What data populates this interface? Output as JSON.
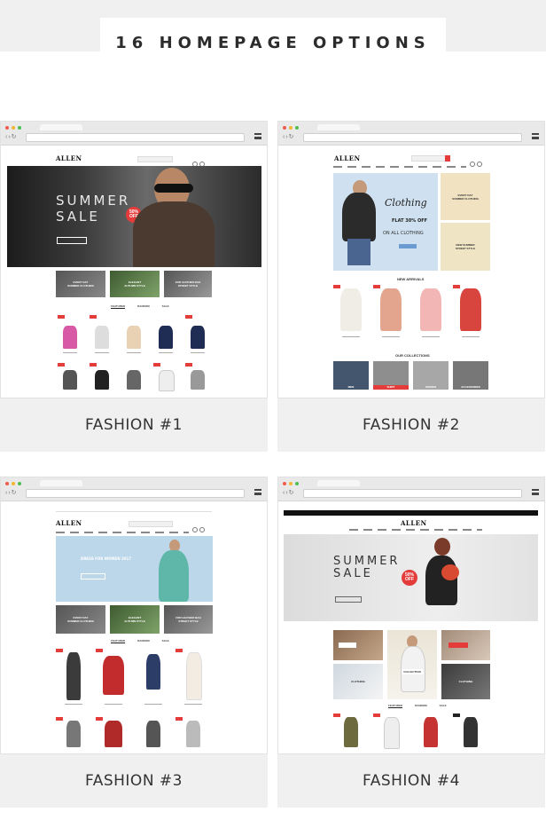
{
  "page": {
    "title": "16 HOMEPAGE OPTIONS"
  },
  "colors": {
    "accent": "#e43b3b",
    "dot_red": "#ef5b4c",
    "dot_yellow": "#f2b632",
    "dot_green": "#4cbf52",
    "card_bg": "#f0f0f0"
  },
  "cards": [
    {
      "caption": "FASHION #1",
      "logo": "ALLEN",
      "hero_line1": "SUMMER",
      "hero_line2": "SALE",
      "badge": "50% OFF",
      "tabs": [
        "FEATURED",
        "RANDOM",
        "SALE"
      ]
    },
    {
      "caption": "FASHION #2",
      "logo": "ALLEN",
      "hero_line1": "Clothing",
      "hero_line2": "FLAT 30% OFF",
      "hero_line3": "ON ALL CLOTHING",
      "section1": "NEW ARRIVALS",
      "section2": "OUR COLLECTIONS",
      "collections": [
        "MEN",
        "SHIRT",
        "WOMEN",
        "ACCESSORIES"
      ]
    },
    {
      "caption": "FASHION #3",
      "logo": "ALLEN",
      "hero_line1": "DRESS FOR WOMEN 2017",
      "tabs": [
        "FEATURED",
        "RANDOM",
        "SALE"
      ]
    },
    {
      "caption": "FASHION #4",
      "logo": "ALLEN",
      "hero_line1": "SUMMER",
      "hero_line2": "SALE",
      "badge": "50% OFF",
      "tabs": [
        "FEATURED",
        "RANDOM",
        "SALE"
      ],
      "tile_text": "COLLECTION"
    }
  ],
  "icons": {
    "browser_menu": "hamburger-icon",
    "back": "arrow-left-icon",
    "forward": "arrow-right-icon",
    "reload": "reload-icon"
  }
}
